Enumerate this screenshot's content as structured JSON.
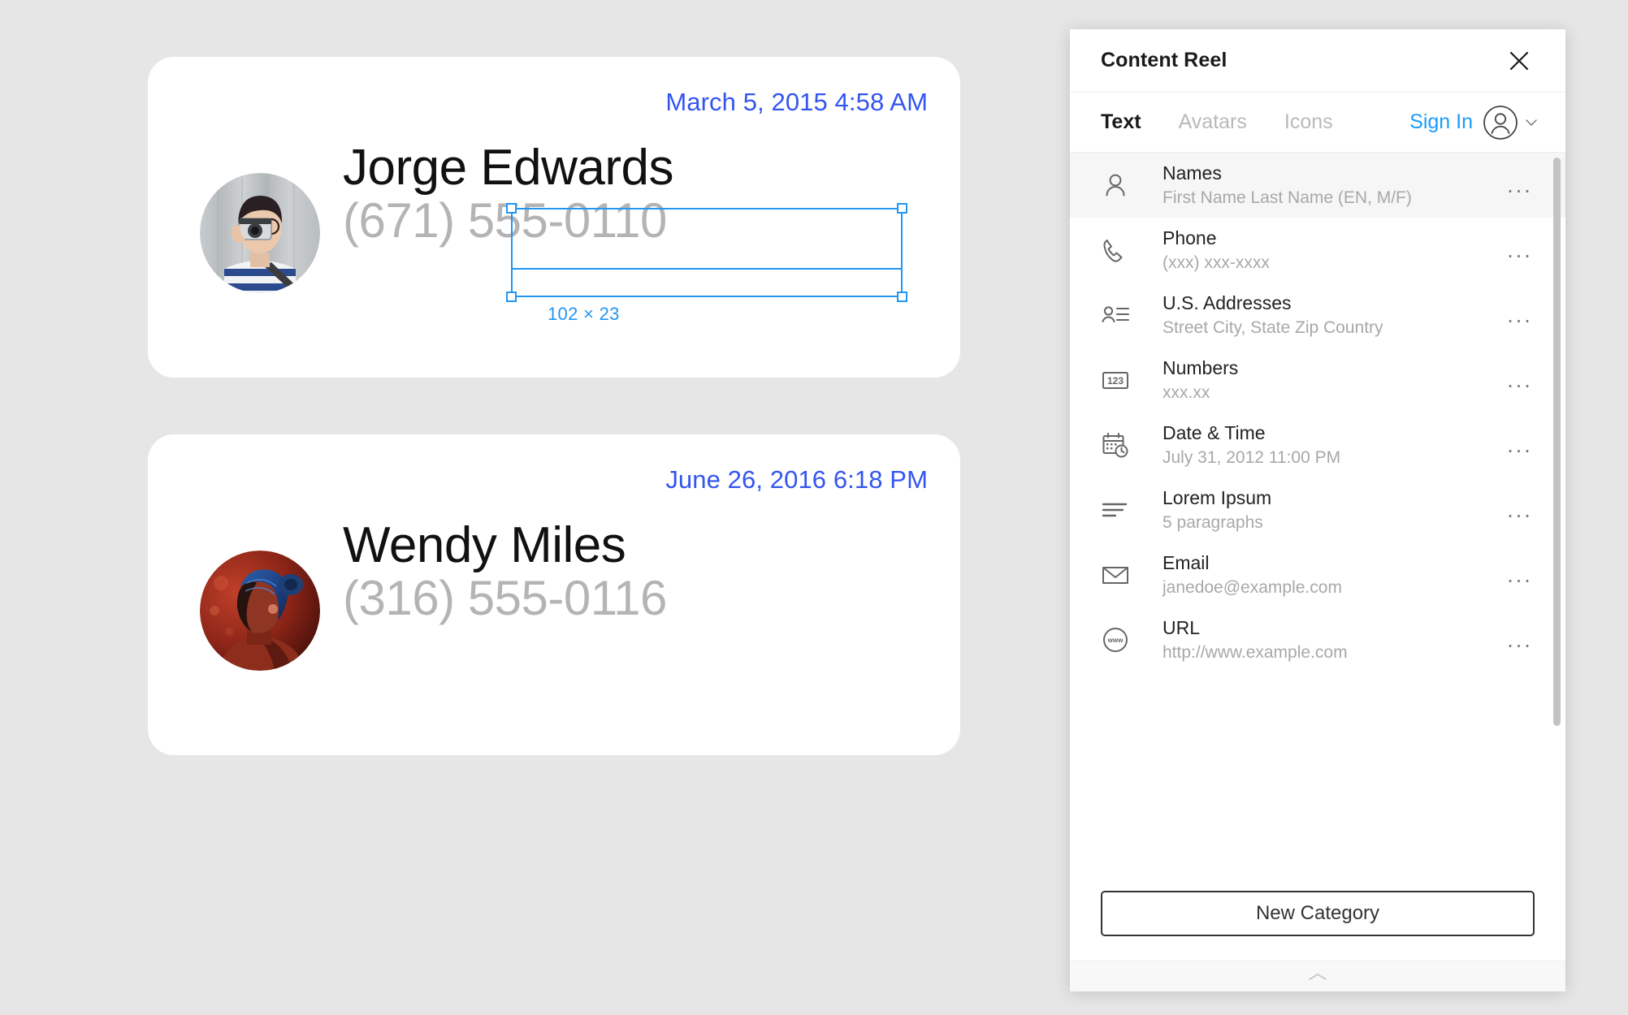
{
  "canvas": {
    "background_color": "#e6e6e6",
    "cards": [
      {
        "id": "card-1",
        "date": "March 5, 2015 4:58 AM",
        "name": "Jorge Edwards",
        "phone": "(671) 555-0110",
        "avatar_alt": "Young man holding a film camera, blue and white striped shirt, wooden wall background",
        "selected": true
      },
      {
        "id": "card-2",
        "date": "June 26, 2016 6:18 PM",
        "name": "Wendy Miles",
        "phone": "(316) 555-0116",
        "avatar_alt": "Portrait of a person with blue hair lit in red and blue neon light",
        "selected": false
      }
    ],
    "selection": {
      "size_badge": "102 × 23",
      "accent_color": "#2196f3"
    },
    "date_color": "#3355ee",
    "phone_color": "#b4b4b4"
  },
  "panel": {
    "title": "Content Reel",
    "close_label": "×",
    "tabs": [
      {
        "label": "Text",
        "active": true
      },
      {
        "label": "Avatars",
        "active": false
      },
      {
        "label": "Icons",
        "active": false
      }
    ],
    "signin": {
      "label": "Sign In",
      "color": "#1a9cfc"
    },
    "rows": [
      {
        "icon": "person-icon",
        "title": "Names",
        "subtitle": "First Name Last Name (EN, M/F)",
        "more_label": "...",
        "selected": true
      },
      {
        "icon": "phone-icon",
        "title": "Phone",
        "subtitle": "(xxx) xxx-xxxx",
        "more_label": "...",
        "selected": false
      },
      {
        "icon": "address-icon",
        "title": "U.S. Addresses",
        "subtitle": "Street City, State Zip Country",
        "more_label": "...",
        "selected": false
      },
      {
        "icon": "numbers-icon",
        "title": "Numbers",
        "subtitle": "xxx.xx",
        "more_label": "...",
        "selected": false
      },
      {
        "icon": "calendar-clock-icon",
        "title": "Date & Time",
        "subtitle": "July 31, 2012 11:00 PM",
        "more_label": "...",
        "selected": false
      },
      {
        "icon": "paragraph-lines-icon",
        "title": "Lorem Ipsum",
        "subtitle": "5 paragraphs",
        "more_label": "...",
        "selected": false
      },
      {
        "icon": "envelope-icon",
        "title": "Email",
        "subtitle": "janedoe@example.com",
        "more_label": "...",
        "selected": false
      },
      {
        "icon": "www-globe-icon",
        "title": "URL",
        "subtitle": "http://www.example.com",
        "more_label": "...",
        "selected": false
      }
    ],
    "footer": {
      "new_category_label": "New Category"
    }
  }
}
